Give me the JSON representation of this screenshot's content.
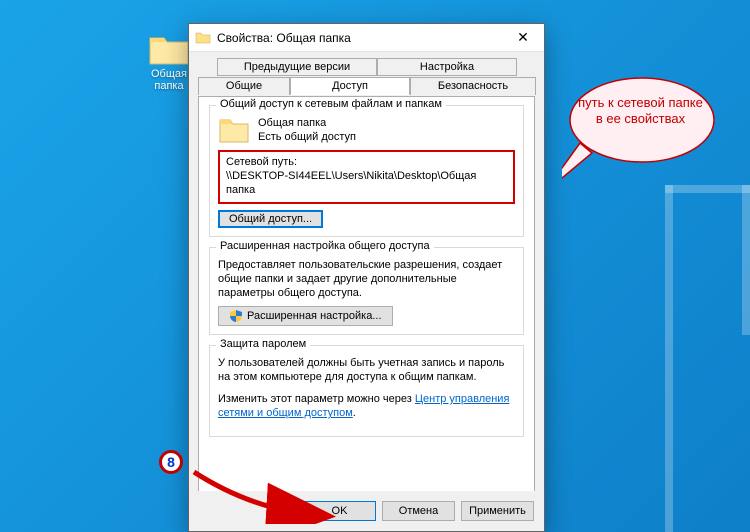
{
  "desktop": {
    "icon_label": "Общая\nпапка"
  },
  "dialog": {
    "title": "Свойства: Общая папка",
    "tabs": {
      "prev_versions": "Предыдущие версии",
      "settings": "Настройка",
      "general": "Общие",
      "access": "Доступ",
      "security": "Безопасность"
    },
    "share_group": {
      "title": "Общий доступ к сетевым файлам и папкам",
      "folder_name": "Общая папка",
      "status": "Есть общий доступ",
      "path_label": "Сетевой путь:",
      "path_value": "\\\\DESKTOP-SI44EEL\\Users\\Nikita\\Desktop\\Общая папка",
      "share_btn": "Общий доступ..."
    },
    "adv_group": {
      "title": "Расширенная настройка общего доступа",
      "desc": "Предоставляет пользовательские разрешения, создает общие папки и задает другие дополнительные параметры общего доступа.",
      "btn": "Расширенная настройка..."
    },
    "protect_group": {
      "title": "Защита паролем",
      "line1": "У пользователей должны быть учетная запись и пароль на этом компьютере для доступа к общим папкам.",
      "line2_pre": "Изменить этот параметр можно через ",
      "link": "Центр управления сетями и общим доступом",
      "line2_post": "."
    },
    "buttons": {
      "ok": "OK",
      "cancel": "Отмена",
      "apply": "Применить"
    }
  },
  "callout": {
    "text": "путь к сетевой папке в ее свойствах"
  },
  "badge": {
    "num": "8"
  }
}
